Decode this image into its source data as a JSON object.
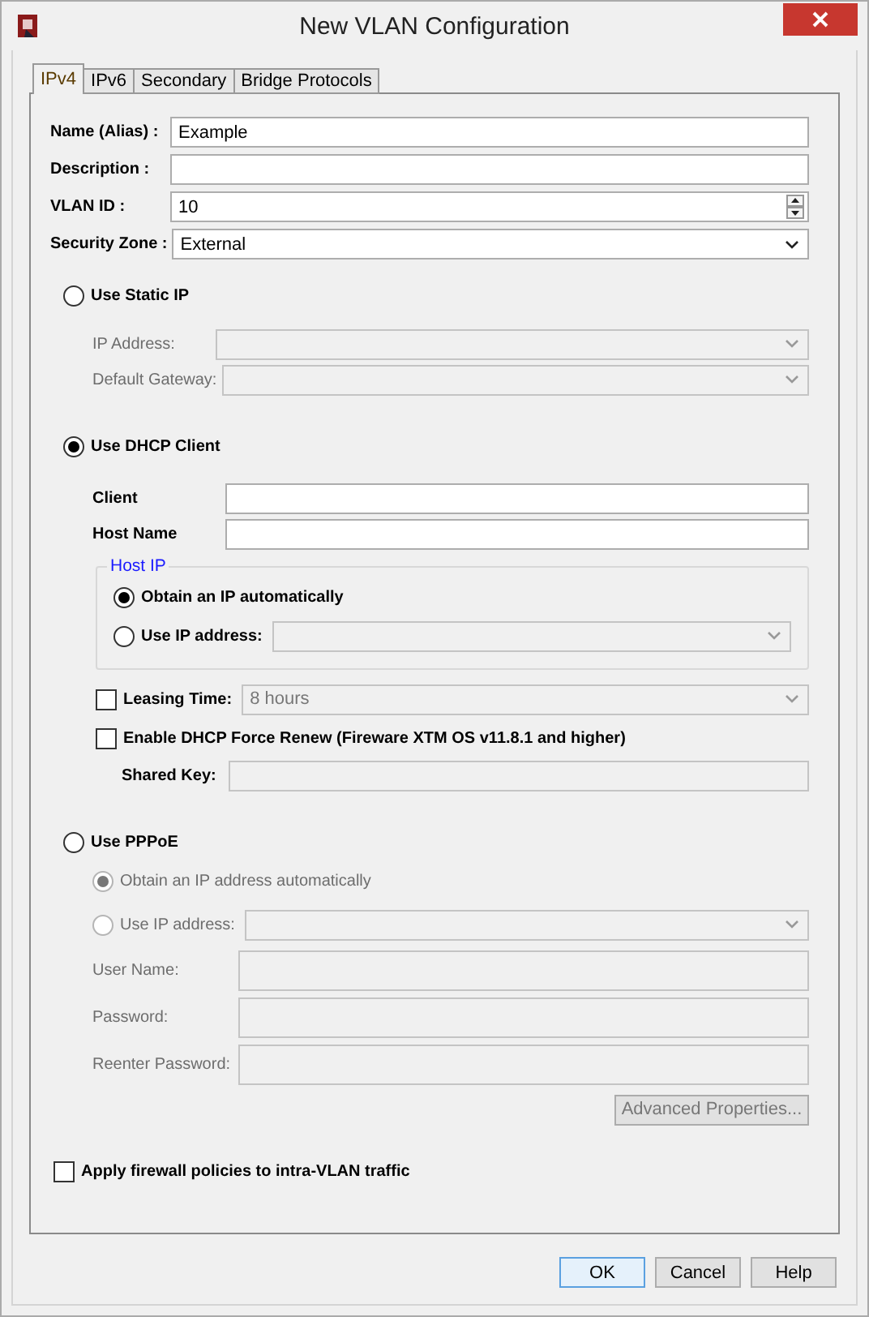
{
  "window": {
    "title": "New VLAN Configuration"
  },
  "tabs": [
    {
      "label": "IPv4",
      "selected": true
    },
    {
      "label": "IPv6",
      "selected": false
    },
    {
      "label": "Secondary",
      "selected": false
    },
    {
      "label": "Bridge Protocols",
      "selected": false
    }
  ],
  "general_fields": [
    {
      "kind": "text",
      "label": "Name (Alias) :",
      "value": "Example"
    },
    {
      "kind": "text",
      "label": "Description :"
    },
    {
      "kind": "spinner",
      "label": "VLAN ID :",
      "value": "10"
    },
    {
      "kind": "select",
      "label": "Security Zone :",
      "value": "External"
    }
  ],
  "static_ip": {
    "label": "Use Static IP",
    "selected": false,
    "fields": [
      {
        "label": "IP Address:",
        "kind": "select",
        "disabled": true
      },
      {
        "label": "Default Gateway:",
        "kind": "select",
        "disabled": true
      }
    ]
  },
  "dhcp_client": {
    "label": "Use DHCP Client",
    "selected": true,
    "fields": [
      {
        "label": "Client",
        "disabled": false
      },
      {
        "label": "Host Name",
        "disabled": false
      }
    ],
    "host_ip": {
      "title": "Host IP",
      "options": [
        {
          "label": "Obtain an IP automatically",
          "kind": "plain",
          "selected": true
        },
        {
          "label": "Use IP address:",
          "kind": "select",
          "selected": false
        }
      ]
    },
    "leasing_time": {
      "label": "Leasing Time:",
      "checked": false,
      "value": "8 hours"
    },
    "force_renew": {
      "label": "Enable DHCP Force Renew (Fireware XTM OS v11.8.1 and higher)",
      "checked": false
    },
    "shared_key": {
      "label": "Shared Key:",
      "disabled": true
    }
  },
  "pppoe": {
    "label": "Use PPPoE",
    "selected": false,
    "options": [
      {
        "label": "Obtain an IP address automatically",
        "kind": "plain",
        "selected": true,
        "disabled": true
      },
      {
        "label": "Use IP address:",
        "kind": "select",
        "selected": false,
        "disabled": true
      }
    ],
    "fields": [
      {
        "label": "User Name:",
        "disabled": true
      },
      {
        "label": "Password:",
        "disabled": true
      },
      {
        "label": "Reenter Password:",
        "disabled": true
      }
    ],
    "advanced_button": {
      "label": "Advanced Properties...",
      "disabled": true
    }
  },
  "intra_vlan": {
    "label": "Apply firewall policies to intra-VLAN traffic",
    "checked": false
  },
  "buttons": [
    {
      "label": "OK",
      "default": true
    },
    {
      "label": "Cancel",
      "default": false
    },
    {
      "label": "Help",
      "default": false
    }
  ]
}
